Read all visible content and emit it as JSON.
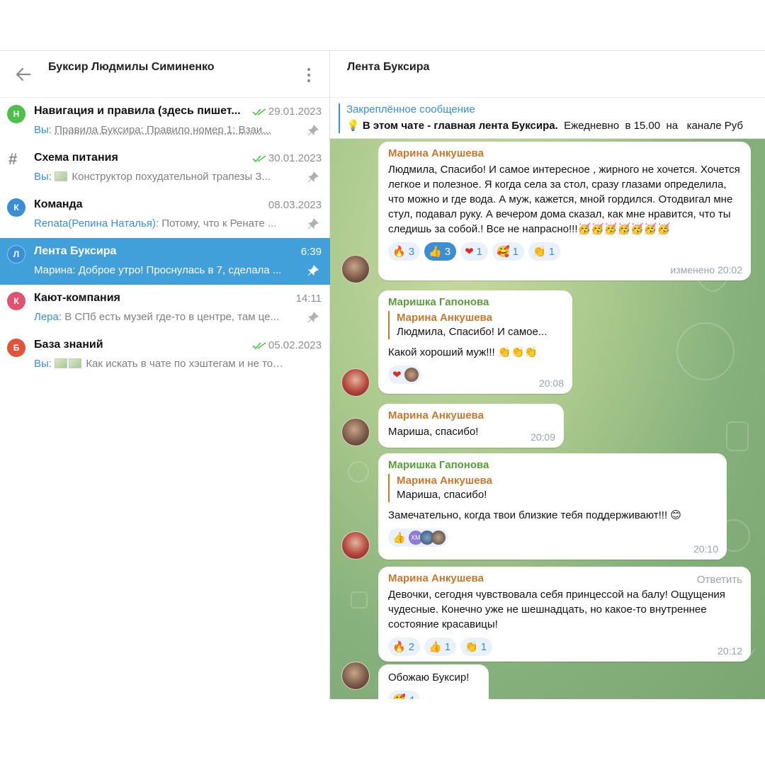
{
  "left_panel": {
    "title": "Буксир Людмилы Симиненко",
    "chats": [
      {
        "avatar_letter": "Н",
        "avatar_color": "#4fbf4c",
        "name": "Навигация и правила (здесь пишет...",
        "date": "29.01.2023",
        "read": true,
        "sender": "Вы:",
        "preview": "Правила Буксира:  Правило номер 1: Взаи..."
      },
      {
        "avatar_letter": "#",
        "name": "Схема питания",
        "date": "30.01.2023",
        "read": true,
        "sender": "Вы:",
        "preview": "Конструктор похудательной трапезы З..."
      },
      {
        "avatar_letter": "К",
        "avatar_color": "#3a8ed3",
        "name": "Команда",
        "date": "08.03.2023",
        "read": false,
        "sender": "Renata(Репина Наталья):",
        "preview": "Потому, что к Ренате ..."
      },
      {
        "avatar_letter": "Л",
        "avatar_color": "#3a8ed3",
        "name": "Лента Буксира",
        "date": "6:39",
        "read": false,
        "sender": "",
        "preview": "Марина: Доброе утро! Проснулась в 7, сделала ..."
      },
      {
        "avatar_letter": "К",
        "avatar_color": "#e0536f",
        "name": "Кают-компания",
        "date": "14:11",
        "read": false,
        "sender": "Лера:",
        "preview": "В СПб есть музей где-то в центре, там це..."
      },
      {
        "avatar_letter": "Б",
        "avatar_color": "#e0533c",
        "name": "База знаний",
        "date": "05.02.2023",
        "read": true,
        "sender": "Вы:",
        "preview": "Как искать в чате по хэштегам и не только."
      }
    ]
  },
  "right_panel": {
    "title": "Лента Буксира",
    "pinned": {
      "label": "Закреплённое сообщение",
      "bold_text": "В этом чате - главная лента Буксира.",
      "text": "  Ежедневно  в 15.00  на   канале Руб"
    }
  },
  "messages": [
    {
      "sender": "Марина Анкушева",
      "text": "Людмила, Спасибо! И самое интересное , жирного не хочется. Хочется легкое и полезное. Я когда села за стол, сразу глазами определила, что можно и где вода. А муж, кажется, мной гордился. Отодвигал мне стул, подавал руку. А вечером дома сказал, как мне нравится, что ты следишь за собой.! Все не напрасно!!!🥳🥳🥳🥳🥳🥳🥳",
      "reactions": [
        {
          "emoji": "🔥",
          "count": "3"
        },
        {
          "emoji": "👍",
          "count": "3",
          "selected": true
        },
        {
          "emoji": "❤",
          "count": "1"
        },
        {
          "emoji": "🥰",
          "count": "1"
        },
        {
          "emoji": "👏",
          "count": "1"
        }
      ],
      "time": "изменено 20:02"
    },
    {
      "sender": "Маришка Гапонова",
      "reply_name": "Марина Анкушева",
      "reply_text": "Людмила, Спасибо! И самое...",
      "text": "Какой хороший муж!!! 👏👏👏",
      "reaction_emoji": "❤",
      "time": "20:08"
    },
    {
      "sender": "Марина Анкушева",
      "text": "Мариша, спасибо!",
      "time": "20:09"
    },
    {
      "sender": "Маришка Гапонова",
      "reply_name": "Марина Анкушева",
      "reply_text": "Мариша, спасибо!",
      "text": "Замечательно, когда твои близкие тебя поддерживают!!! 😊",
      "reaction_emoji": "👍",
      "reaction_avatar": "ХМ",
      "time": "20:10"
    },
    {
      "sender": "Марина Анкушева",
      "reply_action": "Ответить",
      "text": "Девочки, сегодня чувствовала себя принцессой на балу! Ощущения чудесные. Конечно уже не шешнадцать, но какое-то внутреннее состояние красавицы!",
      "reactions": [
        {
          "emoji": "🔥",
          "count": "2"
        },
        {
          "emoji": "👍",
          "count": "1"
        },
        {
          "emoji": "👏",
          "count": "1"
        }
      ],
      "time": "20:12"
    },
    {
      "text": "Обожаю Буксир!",
      "reactions": [
        {
          "emoji": "🥰",
          "count": "4"
        }
      ]
    }
  ]
}
